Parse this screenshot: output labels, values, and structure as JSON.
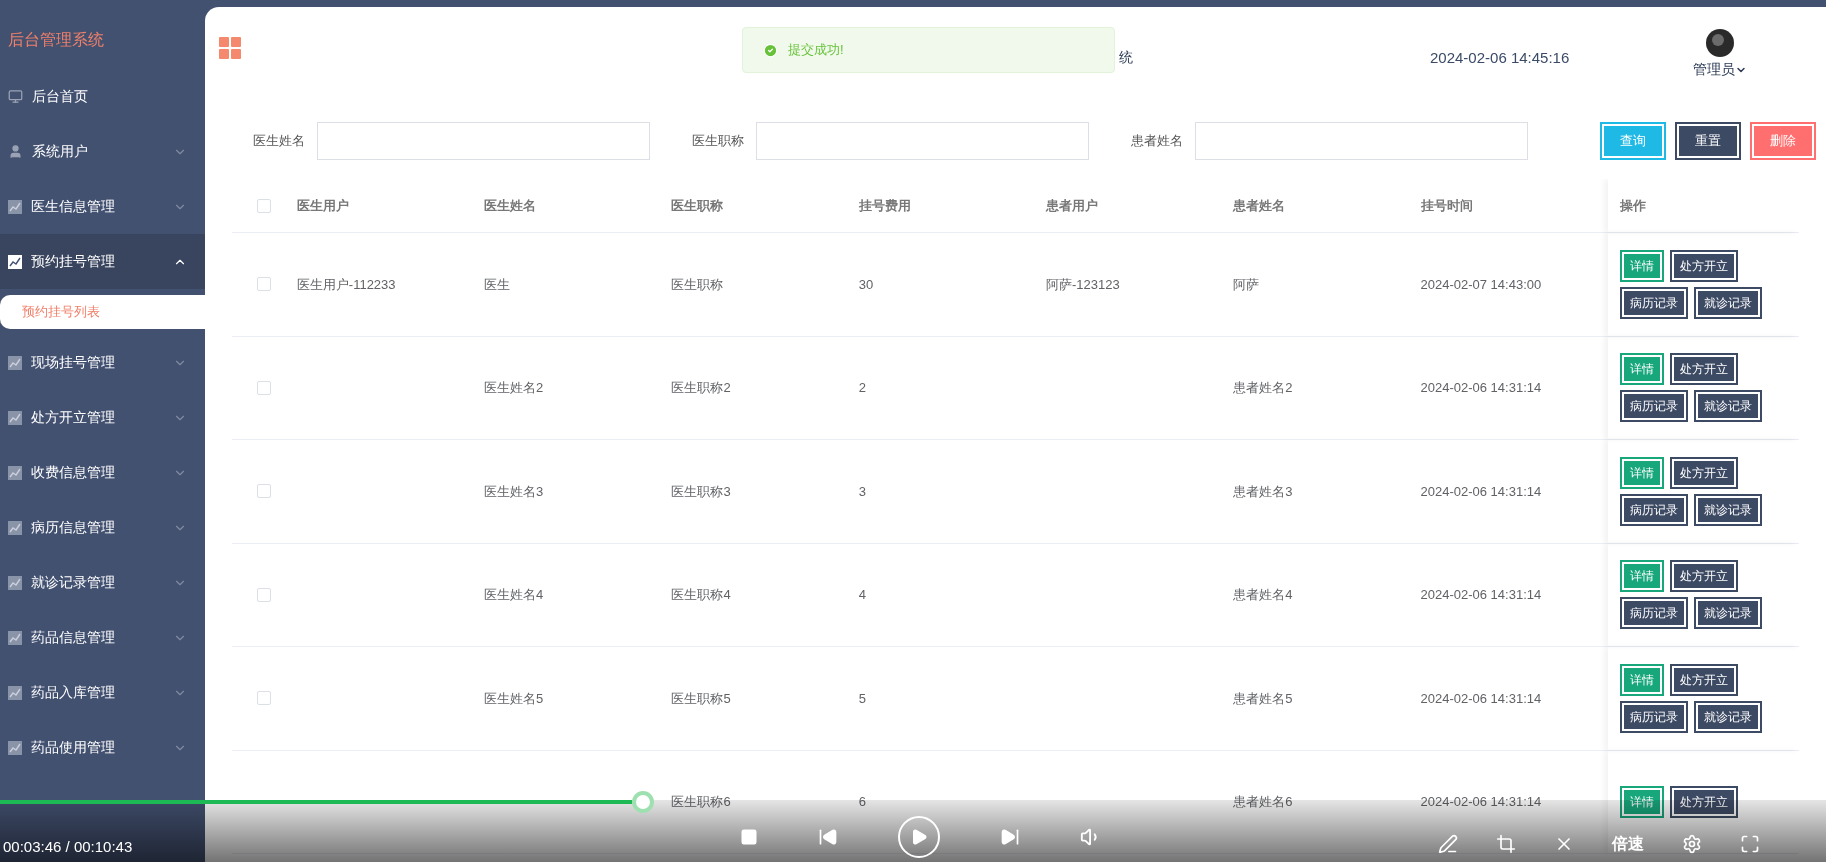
{
  "sidebar": {
    "title": "后台管理系统",
    "items": [
      {
        "label": "后台首页"
      },
      {
        "label": "系统用户",
        "expanded": false
      },
      {
        "label": "医生信息管理",
        "expanded": false
      },
      {
        "label": "预约挂号管理",
        "expanded": true,
        "children": [
          {
            "label": "预约挂号列表",
            "selected": true
          }
        ]
      },
      {
        "label": "现场挂号管理",
        "expanded": false
      },
      {
        "label": "处方开立管理",
        "expanded": false
      },
      {
        "label": "收费信息管理",
        "expanded": false
      },
      {
        "label": "病历信息管理",
        "expanded": false
      },
      {
        "label": "就诊记录管理",
        "expanded": false
      },
      {
        "label": "药品信息管理",
        "expanded": false
      },
      {
        "label": "药品入库管理",
        "expanded": false
      },
      {
        "label": "药品使用管理",
        "expanded": false
      }
    ]
  },
  "header": {
    "title_fragment": "统",
    "datetime": "2024-02-06 14:45:16",
    "user": "管理员"
  },
  "toast": {
    "message": "提交成功!"
  },
  "filters": [
    {
      "label": "医生姓名"
    },
    {
      "label": "医生职称"
    },
    {
      "label": "患者姓名"
    }
  ],
  "filter_buttons": [
    {
      "label": "查询",
      "kind": "primary"
    },
    {
      "label": "重置",
      "kind": "dark"
    },
    {
      "label": "删除",
      "kind": "danger"
    }
  ],
  "table": {
    "columns": [
      "医生用户",
      "医生姓名",
      "医生职称",
      "挂号费用",
      "患者用户",
      "患者姓名",
      "挂号时间",
      "操作"
    ],
    "header_checked": false,
    "rows": [
      {
        "checked": false,
        "cells": [
          "医生用户-112233",
          "医生",
          "医生职称",
          "30",
          "阿萨-123123",
          "阿萨",
          "2024-02-07 14:43:00"
        ],
        "actions": [
          {
            "label": "详情",
            "kind": "success"
          },
          {
            "label": "处方开立",
            "kind": "dark"
          },
          {
            "label": "病历记录",
            "kind": "dark"
          },
          {
            "label": "就诊记录",
            "kind": "dark"
          }
        ]
      },
      {
        "checked": false,
        "cells": [
          "",
          "医生姓名2",
          "医生职称2",
          "2",
          "",
          "患者姓名2",
          "2024-02-06 14:31:14"
        ],
        "actions": [
          {
            "label": "详情",
            "kind": "success"
          },
          {
            "label": "处方开立",
            "kind": "dark"
          },
          {
            "label": "病历记录",
            "kind": "dark"
          },
          {
            "label": "就诊记录",
            "kind": "dark"
          }
        ]
      },
      {
        "checked": false,
        "cells": [
          "",
          "医生姓名3",
          "医生职称3",
          "3",
          "",
          "患者姓名3",
          "2024-02-06 14:31:14"
        ],
        "actions": [
          {
            "label": "详情",
            "kind": "success"
          },
          {
            "label": "处方开立",
            "kind": "dark"
          },
          {
            "label": "病历记录",
            "kind": "dark"
          },
          {
            "label": "就诊记录",
            "kind": "dark"
          }
        ]
      },
      {
        "checked": false,
        "cells": [
          "",
          "医生姓名4",
          "医生职称4",
          "4",
          "",
          "患者姓名4",
          "2024-02-06 14:31:14"
        ],
        "actions": [
          {
            "label": "详情",
            "kind": "success"
          },
          {
            "label": "处方开立",
            "kind": "dark"
          },
          {
            "label": "病历记录",
            "kind": "dark"
          },
          {
            "label": "就诊记录",
            "kind": "dark"
          }
        ]
      },
      {
        "checked": false,
        "cells": [
          "",
          "医生姓名5",
          "医生职称5",
          "5",
          "",
          "患者姓名5",
          "2024-02-06 14:31:14"
        ],
        "actions": [
          {
            "label": "详情",
            "kind": "success"
          },
          {
            "label": "处方开立",
            "kind": "dark"
          },
          {
            "label": "病历记录",
            "kind": "dark"
          },
          {
            "label": "就诊记录",
            "kind": "dark"
          }
        ]
      },
      {
        "cells": [
          "",
          "",
          "医生职称6",
          "6",
          "",
          "患者姓名6",
          "2024-02-06 14:31:14"
        ],
        "actions": [
          {
            "label": "详情",
            "kind": "success"
          },
          {
            "label": "处方开立",
            "kind": "dark"
          }
        ]
      }
    ]
  },
  "player": {
    "time": "00:03:46 / 00:10:43",
    "level": 0.352,
    "speed": "倍速"
  }
}
